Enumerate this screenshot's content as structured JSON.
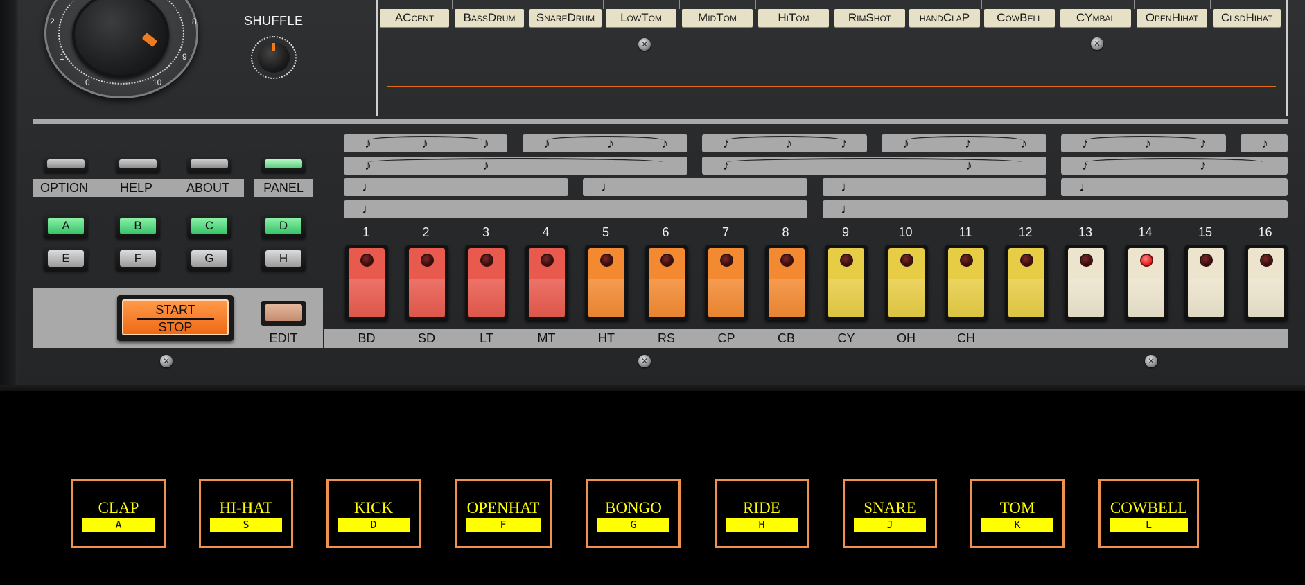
{
  "tempo_dial": {
    "numbers": [
      "2",
      "8",
      "1",
      "9",
      "0",
      "10"
    ]
  },
  "shuffle": {
    "label": "SHUFFLE"
  },
  "instrument_tabs": [
    "ACcent",
    "BassDrum",
    "SnareDrum",
    "LowTom",
    "MidTom",
    "HiTom",
    "RimShot",
    "handClaP",
    "CowBell",
    "CYmbal",
    "OpenHihat",
    "ClsdHihat"
  ],
  "menu": {
    "option": "OPTION",
    "help": "HELP",
    "about": "ABOUT",
    "panel": "PANEL"
  },
  "pattern_buttons": [
    "A",
    "B",
    "C",
    "D",
    "E",
    "F",
    "G",
    "H"
  ],
  "active_patterns": [
    "A",
    "B",
    "C",
    "D"
  ],
  "start_stop": {
    "start": "START",
    "stop": "STOP"
  },
  "edit": {
    "label": "EDIT"
  },
  "steps": [
    "1",
    "2",
    "3",
    "4",
    "5",
    "6",
    "7",
    "8",
    "9",
    "10",
    "11",
    "12",
    "13",
    "14",
    "15",
    "16"
  ],
  "active_step": "14",
  "step_instruments": [
    "BD",
    "SD",
    "LT",
    "MT",
    "HT",
    "RS",
    "CP",
    "CB",
    "CY",
    "OH",
    "CH"
  ],
  "note_symbols": {
    "eighth": "♪",
    "quarter": "♩"
  },
  "colors": {
    "red": "#e95a4e",
    "orange": "#f38a32",
    "yellow": "#e7cd45",
    "cream": "#ece4cc",
    "accent": "#e46a1a",
    "pad_border": "#f0924d",
    "pad_text": "#ffff00"
  },
  "pads": [
    {
      "name": "CLAP",
      "key": "A"
    },
    {
      "name": "HI-HAT",
      "key": "S"
    },
    {
      "name": "KICK",
      "key": "D"
    },
    {
      "name": "OPENHAT",
      "key": "F"
    },
    {
      "name": "BONGO",
      "key": "G"
    },
    {
      "name": "RIDE",
      "key": "H"
    },
    {
      "name": "SNARE",
      "key": "J"
    },
    {
      "name": "TOM",
      "key": "K"
    },
    {
      "name": "COWBELL",
      "key": "L"
    }
  ]
}
